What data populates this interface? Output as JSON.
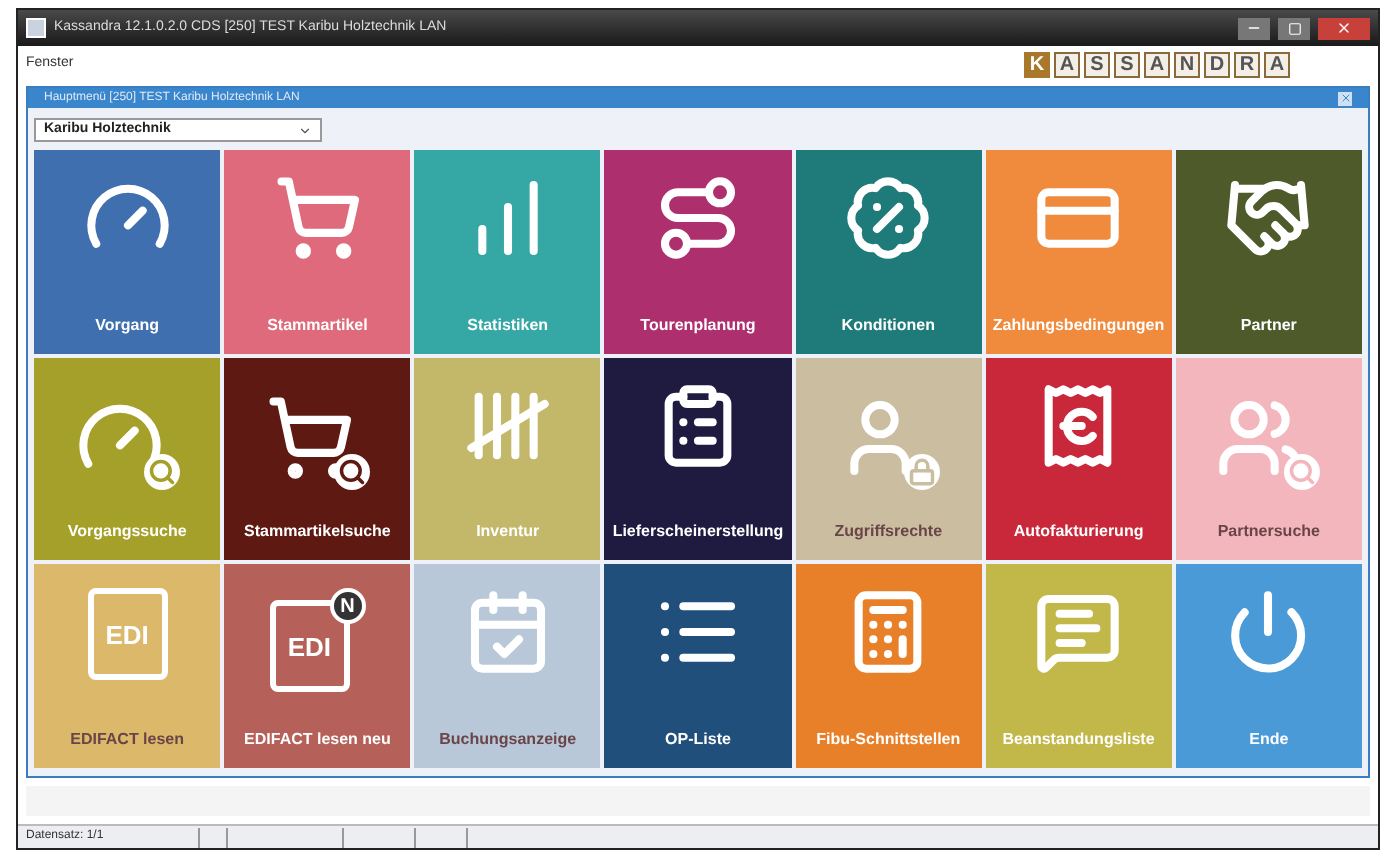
{
  "window": {
    "title": "Kassandra 12.1.0.2.0 CDS [250] TEST Karibu Holztechnik LAN"
  },
  "menu": [
    "Fenster"
  ],
  "logo": [
    {
      "letter": "K",
      "accent": true
    },
    {
      "letter": "A",
      "accent": false
    },
    {
      "letter": "S",
      "accent": false
    },
    {
      "letter": "S",
      "accent": false
    },
    {
      "letter": "A",
      "accent": false
    },
    {
      "letter": "N",
      "accent": false
    },
    {
      "letter": "D",
      "accent": false
    },
    {
      "letter": "R",
      "accent": false
    },
    {
      "letter": "A",
      "accent": false
    }
  ],
  "panel": {
    "title": "Hauptmenü [250] TEST Karibu Holztechnik LAN",
    "company": "Karibu Holztechnik"
  },
  "tiles": [
    {
      "label": "Vorgang",
      "color": "#3f6fae"
    },
    {
      "label": "Stammartikel",
      "color": "#de6a7b"
    },
    {
      "label": "Statistiken",
      "color": "#35a8a6"
    },
    {
      "label": "Tourenplanung",
      "color": "#ad2f6e"
    },
    {
      "label": "Konditionen",
      "color": "#1f7a7a"
    },
    {
      "label": "Zahlungsbedingungen",
      "color": "#f08a3c"
    },
    {
      "label": "Partner",
      "color": "#4f5a2a"
    },
    {
      "label": "Vorgangssuche",
      "color": "#a5a02a"
    },
    {
      "label": "Stammartikelsuche",
      "color": "#5e1a12"
    },
    {
      "label": "Inventur",
      "color": "#c3b86a"
    },
    {
      "label": "Lieferscheinerstellung",
      "color": "#1f1a40"
    },
    {
      "label": "Zugriffsrechte",
      "color": "#cbbda0"
    },
    {
      "label": "Autofakturierung",
      "color": "#c8283a"
    },
    {
      "label": "Partnersuche",
      "color": "#f2b6bc"
    },
    {
      "label": "EDIFACT lesen",
      "color": "#dbb86a",
      "icon_text": "EDI"
    },
    {
      "label": "EDIFACT lesen neu",
      "color": "#b56058",
      "icon_text": "EDI",
      "badge": "N"
    },
    {
      "label": "Buchungsanzeige",
      "color": "#b8c8d8"
    },
    {
      "label": "OP-Liste",
      "color": "#1f4f7a"
    },
    {
      "label": "Fibu-Schnittstellen",
      "color": "#e8802a"
    },
    {
      "label": "Beanstandungsliste",
      "color": "#c2b84a"
    },
    {
      "label": "Ende",
      "color": "#4a9ad8"
    }
  ],
  "status_bar": [
    "Datensatz: 1/1"
  ]
}
